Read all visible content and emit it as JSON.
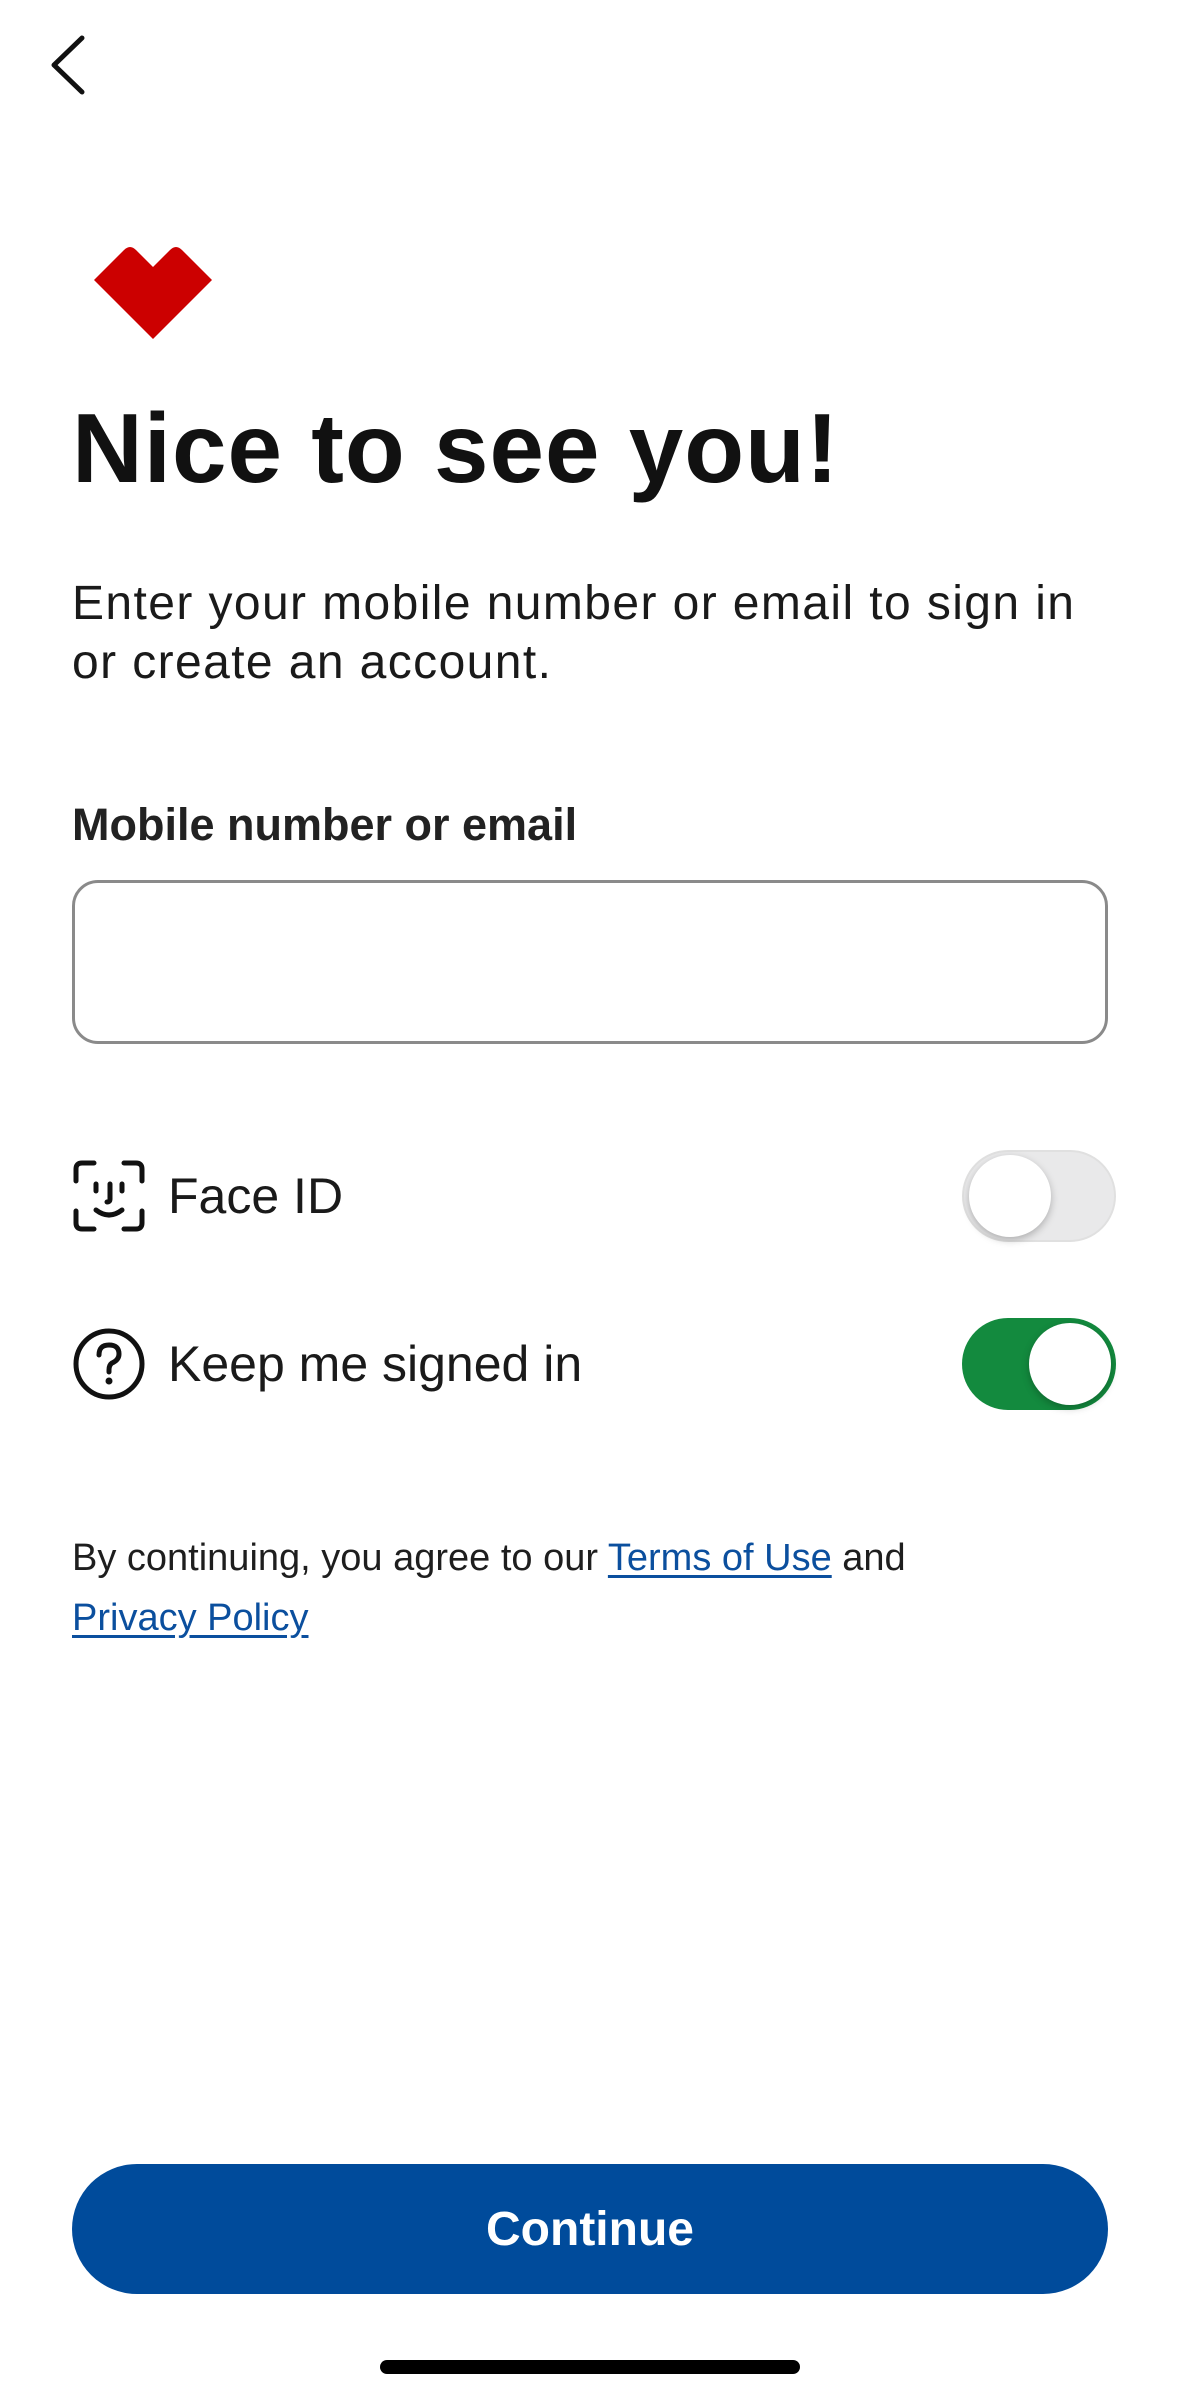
{
  "header": {
    "back_icon": "chevron-left-icon"
  },
  "brand": {
    "logo_icon": "heart-logo-icon",
    "logo_color": "#cc0000"
  },
  "content": {
    "title": "Nice to see you!",
    "subtitle": "Enter your mobile number or email to sign in or create an account."
  },
  "login_field": {
    "label": "Mobile number or email",
    "value": "",
    "placeholder": ""
  },
  "options": {
    "face_id": {
      "icon": "face-id-icon",
      "label": "Face ID",
      "enabled": false
    },
    "keep_signed_in": {
      "icon": "help-circle-icon",
      "label": "Keep me signed in",
      "enabled": true
    }
  },
  "legal": {
    "prefix": "By continuing, you agree to our ",
    "terms_link": "Terms of Use",
    "conjunction": " and ",
    "privacy_link": "Privacy Policy",
    "link_color": "#0b4f9e"
  },
  "actions": {
    "continue_label": "Continue",
    "continue_color": "#004b9b"
  },
  "colors": {
    "toggle_on": "#138a3e",
    "toggle_off": "#e9e9ea"
  }
}
